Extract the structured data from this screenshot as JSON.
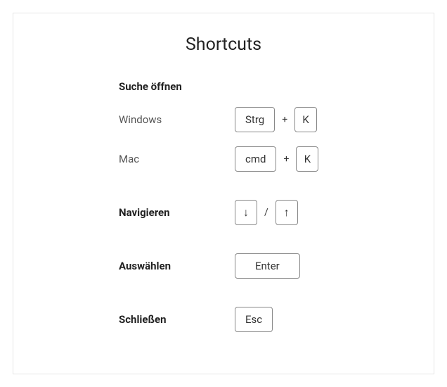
{
  "title": "Shortcuts",
  "sections": {
    "openSearch": {
      "header": "Suche öffnen",
      "windows": {
        "label": "Windows",
        "key1": "Strg",
        "sep": "+",
        "key2": "K"
      },
      "mac": {
        "label": "Mac",
        "key1": "cmd",
        "sep": "+",
        "key2": "K"
      }
    },
    "navigate": {
      "label": "Navigieren",
      "downIcon": "↓",
      "sep": "/",
      "upIcon": "↑"
    },
    "select": {
      "label": "Auswählen",
      "key": "Enter"
    },
    "close": {
      "label": "Schließen",
      "key": "Esc"
    }
  }
}
